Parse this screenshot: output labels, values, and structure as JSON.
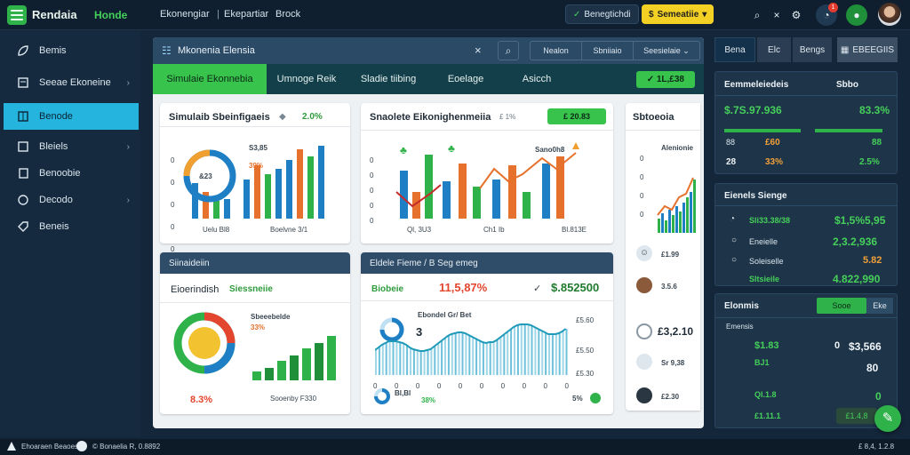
{
  "app": {
    "brand": "Rendaia",
    "brand_sub": "Honde"
  },
  "topnav": {
    "items": [
      "Ekonengiar",
      "Ekepartiar",
      "Brock"
    ]
  },
  "topright": {
    "status_pill": "Benegtichdi",
    "yellow_pill": "Semeatiie",
    "badge_count": "1",
    "accent": "#f2d024"
  },
  "sidebar": {
    "items": [
      {
        "label": "Bemis",
        "icon": "leaf-icon",
        "active": false,
        "chevron": false
      },
      {
        "label": "Seeae Ekoneine",
        "icon": "document-icon",
        "active": false,
        "chevron": true
      },
      {
        "label": "Benode",
        "icon": "grid-icon",
        "active": true,
        "chevron": false
      },
      {
        "label": "Bleiels",
        "icon": "list-icon",
        "active": false,
        "chevron": true
      },
      {
        "label": "Benoobie",
        "icon": "page-icon",
        "active": false,
        "chevron": false
      },
      {
        "label": "Decodo",
        "icon": "badge-icon",
        "active": false,
        "chevron": true
      },
      {
        "label": "Beneis",
        "icon": "tag-icon",
        "active": false,
        "chevron": false
      }
    ]
  },
  "main": {
    "title": "Mkonenia Elensia",
    "tabs": [
      "Simulaie Ekonnebia",
      "Umnoge Reik",
      "Sladie tiibing",
      "Eoelage",
      "Asicch"
    ],
    "tab_button": "✓ 1L,£38",
    "cards": {
      "c1": {
        "title": "Simulaib Sbeinfigaeis",
        "value": "2.0%",
        "pie_center": "&23",
        "label_a": "S3,85",
        "label_b": "39%",
        "axis": "Uelu Bl8",
        "axis2": "Boelvne 3/1",
        "ticks": [
          "0",
          "0",
          "0",
          "0",
          "0"
        ]
      },
      "c2": {
        "title": "Snaolete Eikonighenmeiia",
        "small": "£ 1%",
        "button": "£ 20.83",
        "label": "Sano0h8",
        "axis": "Ql, 3U3",
        "axis2": "Ch1 Ib",
        "axis3": "Bl.813E",
        "ticks": [
          "0",
          "0",
          "0",
          "0",
          "0",
          "0"
        ]
      },
      "c3": {
        "title": "Sbtoeoia",
        "sub": "Alenionie",
        "ticks": [
          "0",
          "0",
          "0",
          "0"
        ],
        "rows": [
          "£1.99",
          "3.5.6",
          "£3,2.10",
          "Sr 9,38",
          "£2.30"
        ]
      },
      "c4": {
        "header": "Siinaideiin",
        "title": "Eioerindish",
        "title2": "Siessneiie",
        "center_label": "Sbeeebelde",
        "pct": "33%",
        "value": "8.3%",
        "axis": "Sooenby F330",
        "ticks": [
          "0",
          "0",
          "0",
          "0",
          "0"
        ]
      },
      "c5": {
        "header": "Eldele Fieme / B Seg emeg",
        "title": "Biobeie",
        "change": "11,5,87%",
        "amount": "$.852500",
        "sub": "Ebondel Gr/ Bet",
        "ring_val": "3",
        "legend_a": "Bl,Bl",
        "legend_b": "38%",
        "legend_c": "5%",
        "y1": "£5.60",
        "y2": "£5.50",
        "y3": "£5.30",
        "ticks": [
          "0",
          "0",
          "0",
          "0",
          "0",
          "0",
          "0",
          "0",
          "0",
          "0"
        ]
      }
    }
  },
  "right": {
    "tabs": [
      "Bena",
      "Elc",
      "Bengs",
      "EBEEGIIS"
    ],
    "p1": {
      "title": "Eemmeleiedeis",
      "col": "Sbbo",
      "v1": "$.7S.97.936",
      "v2": "83.3%",
      "r2a": "88",
      "r2b": "£60",
      "r2c": "88",
      "r3a": "28",
      "r3b": "33%",
      "r3c": "2.5%"
    },
    "p2": {
      "title": "Eienels Sienge",
      "rows": [
        {
          "icon": "clock-icon",
          "label": "Sli33.38/38",
          "value": "$1,5%5,95"
        },
        {
          "icon": "circle-icon",
          "label": "Eneielle",
          "value": "2,3.2,936"
        },
        {
          "icon": "circle-icon",
          "label": "Soleiselle",
          "value": "5.82"
        },
        {
          "icon": "circle-icon",
          "label": "Sltsieile",
          "value": "4.822,990"
        }
      ]
    },
    "p3": {
      "title": "Elonmis",
      "tab_a": "Sooe",
      "tab_b": "Eke",
      "head": "Emensis",
      "rows": [
        {
          "a": "$1.83",
          "b": "0",
          "c": "$3,566"
        },
        {
          "a": "BJ1",
          "b": "",
          "c": "80"
        },
        {
          "a": "Ql.1.8",
          "b": "",
          "c": "0"
        },
        {
          "a": "£1.11.1",
          "b": "",
          "c": "£1.4,8"
        }
      ]
    }
  },
  "status": {
    "left": "Ehoaraen Beaoes",
    "mid": "© Bonaelia R, 0.8892",
    "right": "£ 8,4, 1.2.8"
  }
}
